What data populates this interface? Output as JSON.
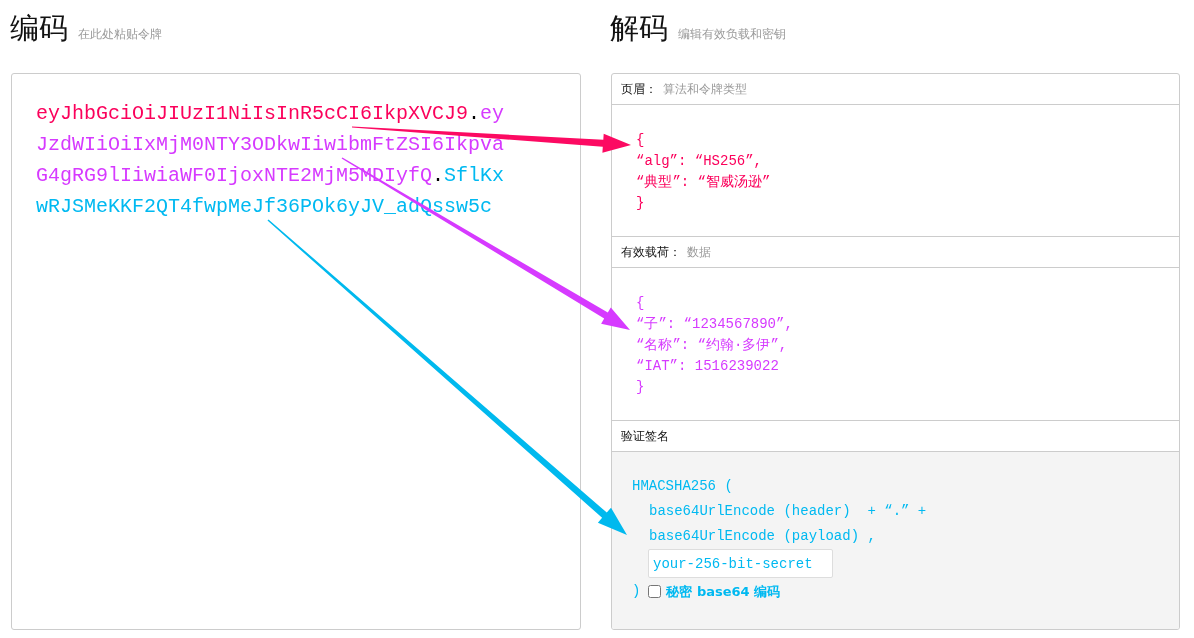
{
  "encoded": {
    "title": "编码",
    "subtitle": "在此处粘贴令牌",
    "token": [
      {
        "text": "eyJhbGciOiJIUzI1NiIsInR5cCI6IkpXVCJ9",
        "color": "#fb015b"
      },
      {
        "text": ".",
        "color": "#000000"
      },
      {
        "text": "eyJzdWIiOiIxMjM0NTY3ODkwIiwibmFtZSI6IkpvaG4gRG9lIiwiaWF0IjoxNTE2MjM5MDIyfQ",
        "color": "#d63aff"
      },
      {
        "text": ".",
        "color": "#000000"
      },
      {
        "text": "SflKxwRJSMeKKF2QT4fwpMeJf36POk6yJV_adQssw5c",
        "color": "#00b9f1"
      }
    ]
  },
  "decoded": {
    "title": "解码",
    "subtitle": "编辑有效负载和密钥",
    "sections": [
      {
        "kind": "json",
        "label": "页眉：",
        "hint": "算法和令牌类型",
        "color": "#fb015b",
        "lines": [
          "{",
          "“alg”: “HS256”,",
          "“典型”: “智威汤逊”",
          "}"
        ]
      },
      {
        "kind": "json",
        "label": "有效载荷：",
        "hint": "数据",
        "color": "#d63aff",
        "lines": [
          "{",
          "“子”: “1234567890”,",
          "“名称”: “约翰·多伊”,",
          "“IAT”: 1516239022",
          "}"
        ]
      },
      {
        "kind": "signature",
        "label": "验证签名",
        "color": "#00b9f1",
        "opening": "HMACSHA256 (",
        "args": [
          "base64UrlEncode (header)  + “.” +",
          "base64UrlEncode (payload) ,"
        ],
        "secret": {
          "value": "your-256-bit-secret"
        },
        "closing": ")",
        "checkbox": {
          "label": "秘密 base64 编码",
          "checked": false
        }
      }
    ]
  },
  "arrows": [
    {
      "color": "#fc0a62"
    },
    {
      "color": "#d63aff"
    },
    {
      "color": "#00b9ee"
    }
  ]
}
